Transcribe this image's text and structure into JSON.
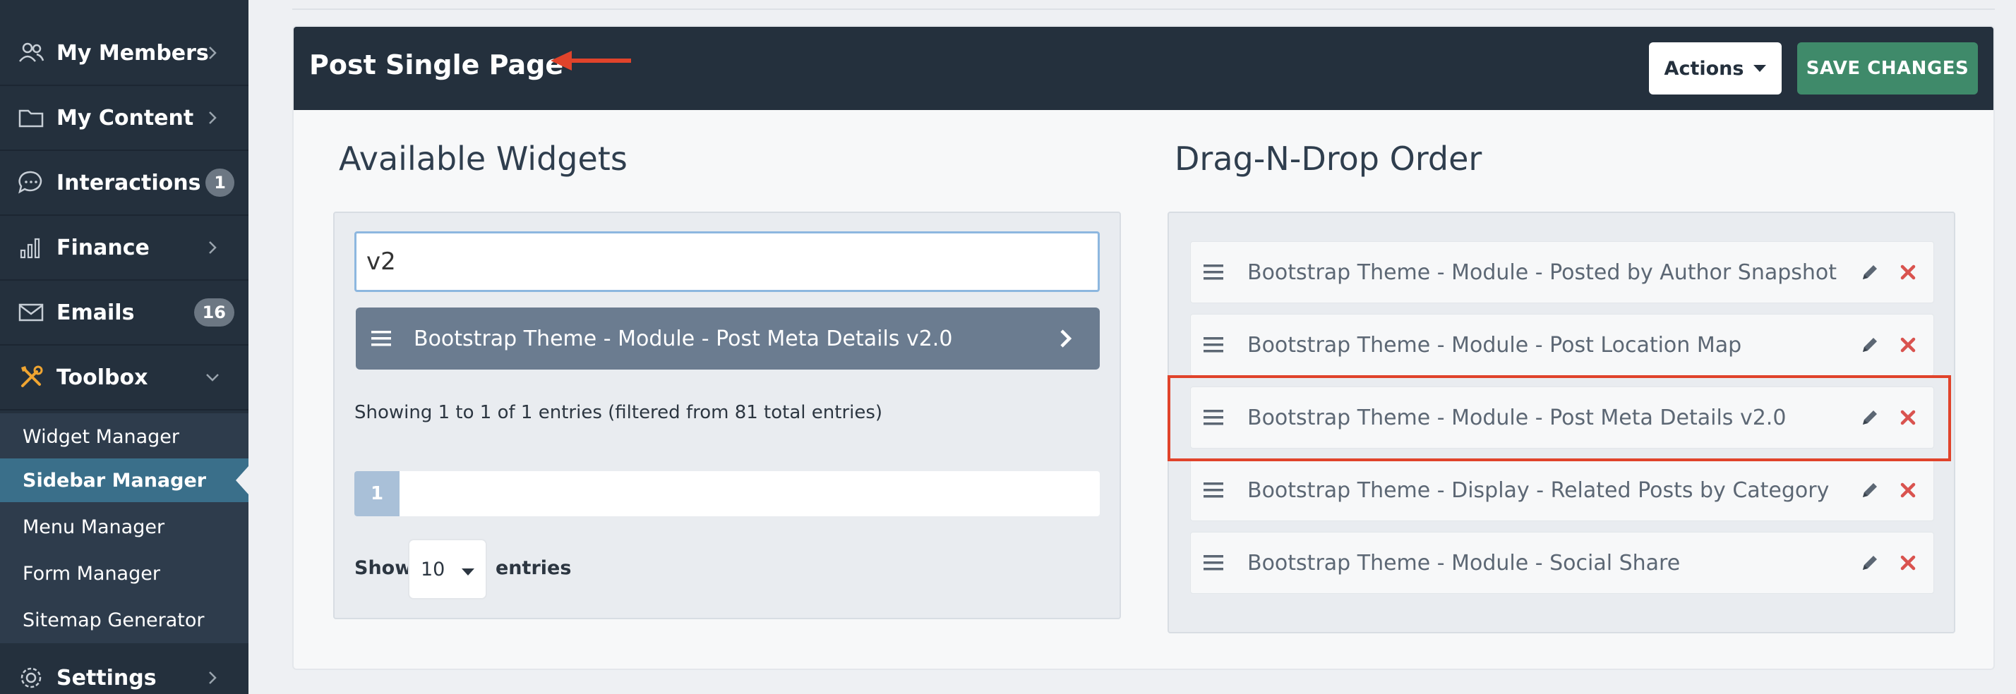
{
  "sidebar": {
    "items": [
      {
        "label": "My Members",
        "icon": "members-icon",
        "arrow": "chevron-right"
      },
      {
        "label": "My Content",
        "icon": "folder-icon",
        "arrow": "chevron-right"
      },
      {
        "label": "Interactions",
        "icon": "chat-icon",
        "badge": "1"
      },
      {
        "label": "Finance",
        "icon": "bar-chart-icon",
        "arrow": "chevron-right"
      },
      {
        "label": "Emails",
        "icon": "envelope-icon",
        "badge": "16"
      },
      {
        "label": "Toolbox",
        "icon": "tools-icon",
        "arrow": "chevron-down"
      },
      {
        "label": "Settings",
        "icon": "gear-icon",
        "arrow": "chevron-right"
      }
    ],
    "submenu": [
      {
        "label": "Widget Manager"
      },
      {
        "label": "Sidebar Manager",
        "active": true
      },
      {
        "label": "Menu Manager"
      },
      {
        "label": "Form Manager"
      },
      {
        "label": "Sitemap Generator"
      }
    ]
  },
  "header": {
    "title": "Post Single Page",
    "actions_label": "Actions",
    "save_label": "SAVE CHANGES"
  },
  "available": {
    "title": "Available Widgets",
    "search_value": "v2",
    "results": [
      {
        "label": "Bootstrap Theme - Module - Post Meta Details v2.0"
      }
    ],
    "info": "Showing 1 to 1 of 1 entries (filtered from 81 total entries)",
    "current_page": "1",
    "show_label": "Show",
    "page_size": "10",
    "entries_label": "entries"
  },
  "order": {
    "title": "Drag-N-Drop Order",
    "items": [
      {
        "label": "Bootstrap Theme - Module - Posted by Author Snapshot"
      },
      {
        "label": "Bootstrap Theme - Module - Post Location Map"
      },
      {
        "label": "Bootstrap Theme - Module - Post Meta Details v2.0",
        "highlighted": true
      },
      {
        "label": "Bootstrap Theme - Display - Related Posts by Category"
      },
      {
        "label": "Bootstrap Theme - Module - Social Share"
      }
    ]
  },
  "colors": {
    "sidebar_bg": "#24303d",
    "active_item": "#3a6f8a",
    "save_button": "#3f8a6a",
    "highlight": "#e0432b",
    "delete_icon": "#d9534f",
    "arrow": "#e0432b"
  }
}
